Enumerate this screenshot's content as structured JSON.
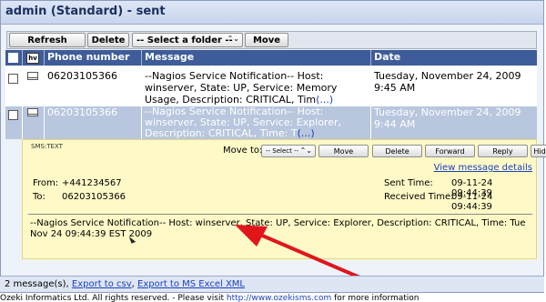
{
  "window": {
    "title": "admin (Standard) - sent"
  },
  "toolbar": {
    "refresh_label": "Refresh",
    "delete_label": "Delete",
    "folder_select": "-- Select a folder --",
    "move_label": "Move"
  },
  "table": {
    "headers": {
      "hv": "hv",
      "phone": "Phone number",
      "message": "Message",
      "date": "Date"
    },
    "rows": [
      {
        "phone": "06203105366",
        "message": "--Nagios Service Notification-- Host: winserver, State: UP, Service: Memory Usage, Description: CRITICAL, Tim",
        "more": "(...)",
        "date": "Tuesday, November 24, 2009 9:45 AM"
      },
      {
        "phone": "06203105366",
        "message": "--Nagios Service Notification-- Host: winserver, State: UP, Service: Explorer, Description: CRITICAL, Time: T",
        "more": "(...)",
        "date": "Tuesday, November 24, 2009 9:44 AM"
      }
    ]
  },
  "detail": {
    "type": "SMS:TEXT",
    "move_to_label": "Move to:",
    "select_label": "-- Select --",
    "move_label": "Move",
    "delete_label": "Delete",
    "forward_label": "Forward",
    "reply_label": "Reply",
    "hide_label": "Hide",
    "view_details": "View message details",
    "from_label": "From:",
    "from_value": "+441234567",
    "to_label": "To:",
    "to_value": "06203105366",
    "sent_label": "Sent Time:",
    "sent_value": "09-11-24 09:44:39",
    "received_label": "Received Time:",
    "received_value": "09-11-24 09:44:39",
    "body": "--Nagios Service Notification-- Host: winserver, State: UP, Service: Explorer, Description: CRITICAL, Time: Tue Nov 24 09:44:39 EST 2009"
  },
  "footer": {
    "count": "2 message(s),",
    "export_csv": "Export to csv",
    "export_excel": "Export to MS Excel XML"
  },
  "copyright": {
    "text_before": "Ozeki Informatics Ltd. All rights reserved. - Please visit",
    "link": "http://www.ozekisms.com",
    "text_after": "for more information"
  },
  "colors": {
    "header": "#3f5c9a",
    "selected_row": "#b8c6de",
    "detail_bg": "#fef9c7",
    "annotation_arrow": "#e0161b"
  }
}
